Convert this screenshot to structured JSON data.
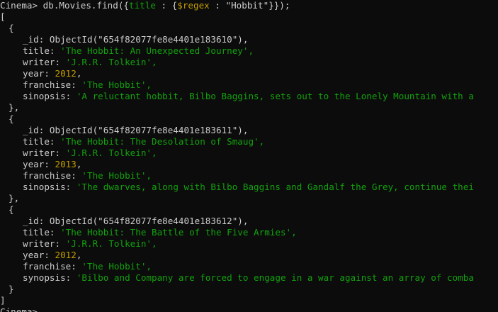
{
  "console": {
    "prompt": "Cinema>",
    "command": {
      "prefix": "db.Movies.find({",
      "field": "title",
      "colon": " : {",
      "operator": "$regex",
      "op_colon": " : ",
      "pattern": "\"Hobbit\"",
      "suffix": "}});"
    },
    "result_open": "[",
    "result_close": "]",
    "doc_open": "{",
    "doc_close_sep": "},",
    "doc_close_last": "}",
    "partial_next_prompt": "Cinema>"
  },
  "documents": [
    {
      "id": "ObjectId(\"654f82077fe8e4401e183610\"),",
      "title_key": "title:",
      "title": "'The Hobbit: An Unexpected Journey',",
      "writer_key": "writer:",
      "writer": "'J.R.R. Tolkein',",
      "year_key": "year:",
      "year": "2012",
      "franchise_key": "franchise:",
      "franchise": "'The Hobbit',",
      "desc_key": "sinopsis:",
      "desc": "'A reluctant hobbit, Bilbo Baggins, sets out to the Lonely Mountain with a"
    },
    {
      "id": "ObjectId(\"654f82077fe8e4401e183611\"),",
      "title_key": "title:",
      "title": "'The Hobbit: The Desolation of Smaug',",
      "writer_key": "writer:",
      "writer": "'J.R.R. Tolkein',",
      "year_key": "year:",
      "year": "2013",
      "franchise_key": "franchise:",
      "franchise": "'The Hobbit',",
      "desc_key": "sinopsis:",
      "desc": "'The dwarves, along with Bilbo Baggins and Gandalf the Grey, continue thei"
    },
    {
      "id": "ObjectId(\"654f82077fe8e4401e183612\"),",
      "title_key": "title:",
      "title": "'The Hobbit: The Battle of the Five Armies',",
      "writer_key": "writer:",
      "writer": "'J.R.R. Tolkein',",
      "year_key": "year:",
      "year": "2012",
      "franchise_key": "franchise:",
      "franchise": "'The Hobbit',",
      "desc_key": "synopsis:",
      "desc": "'Bilbo and Company are forced to engage in a war against an array of comba"
    }
  ],
  "colors": {
    "background": "#0c0c0c",
    "text": "#cccccc",
    "string": "#13a10e",
    "number": "#c19c00"
  }
}
